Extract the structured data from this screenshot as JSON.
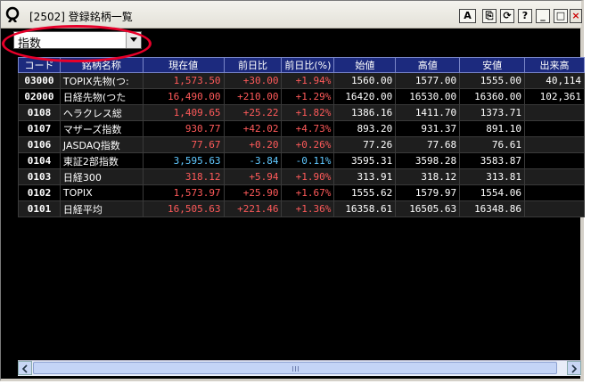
{
  "window": {
    "title": "[2502] 登録銘柄一覧"
  },
  "title_buttons": {
    "alpha": "A",
    "copy": "⎘",
    "refresh": "⟳",
    "help": "?",
    "minimize": "_",
    "maximize": "□",
    "close": "×"
  },
  "category_select": {
    "value": "指数"
  },
  "colors": {
    "up": "#ff5a5a",
    "down": "#60c8ff",
    "neutral": "#ffffff",
    "header_bg": "#1c2a7e",
    "highlight": "#e8002a"
  },
  "table": {
    "columns": [
      "コード",
      "銘柄名称",
      "現在値",
      "前日比",
      "前日比(%)",
      "始値",
      "高値",
      "安値",
      "出来高"
    ],
    "rows": [
      {
        "code": "03000",
        "name": "TOPIX先物(つ:",
        "price": "1,573.50",
        "chg": "+30.00",
        "pct": "+1.94%",
        "open": "1560.00",
        "high": "1577.00",
        "low": "1555.00",
        "vol": "40,114",
        "dir": "up"
      },
      {
        "code": "02000",
        "name": "日経先物(つた",
        "price": "16,490.00",
        "chg": "+210.00",
        "pct": "+1.29%",
        "open": "16420.00",
        "high": "16530.00",
        "low": "16360.00",
        "vol": "102,361",
        "dir": "up"
      },
      {
        "code": "0108",
        "name": "ヘラクレス総",
        "price": "1,409.65",
        "chg": "+25.22",
        "pct": "+1.82%",
        "open": "1386.16",
        "high": "1411.70",
        "low": "1373.71",
        "vol": "",
        "dir": "up"
      },
      {
        "code": "0107",
        "name": "マザーズ指数",
        "price": "930.77",
        "chg": "+42.02",
        "pct": "+4.73%",
        "open": "893.20",
        "high": "931.37",
        "low": "891.10",
        "vol": "",
        "dir": "up"
      },
      {
        "code": "0106",
        "name": "JASDAQ指数",
        "price": "77.67",
        "chg": "+0.20",
        "pct": "+0.26%",
        "open": "77.26",
        "high": "77.68",
        "low": "76.61",
        "vol": "",
        "dir": "up"
      },
      {
        "code": "0104",
        "name": "東証2部指数",
        "price": "3,595.63",
        "chg": "-3.84",
        "pct": "-0.11%",
        "open": "3595.31",
        "high": "3598.28",
        "low": "3583.87",
        "vol": "",
        "dir": "down"
      },
      {
        "code": "0103",
        "name": "日経300",
        "price": "318.12",
        "chg": "+5.94",
        "pct": "+1.90%",
        "open": "313.91",
        "high": "318.12",
        "low": "313.81",
        "vol": "",
        "dir": "up"
      },
      {
        "code": "0102",
        "name": "TOPIX",
        "price": "1,573.97",
        "chg": "+25.90",
        "pct": "+1.67%",
        "open": "1555.62",
        "high": "1579.97",
        "low": "1554.06",
        "vol": "",
        "dir": "up"
      },
      {
        "code": "0101",
        "name": "日経平均",
        "price": "16,505.63",
        "chg": "+221.46",
        "pct": "+1.36%",
        "open": "16358.61",
        "high": "16505.63",
        "low": "16348.86",
        "vol": "",
        "dir": "up"
      }
    ]
  }
}
